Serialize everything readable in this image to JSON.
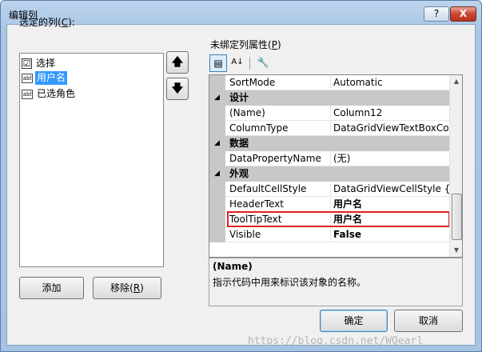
{
  "window": {
    "title": "编辑列",
    "help_label": "?",
    "close_label": "X"
  },
  "left": {
    "label_text": "选定的列",
    "label_accel": "C",
    "items": [
      {
        "icon": "checkbox-icon",
        "icon_glyph": "☑",
        "label": "选择",
        "selected": false
      },
      {
        "icon": "textbox-column-icon",
        "icon_glyph": "abl",
        "label": "用户名",
        "selected": true
      },
      {
        "icon": "textbox-column-icon",
        "icon_glyph": "abl",
        "label": "已选角色",
        "selected": false
      }
    ],
    "move_up_glyph": "🡅",
    "move_down_glyph": "🡇",
    "add_label": "添加",
    "remove_label": "移除",
    "remove_accel": "R"
  },
  "right": {
    "label_text": "未绑定列属性",
    "label_accel": "P",
    "toolbar": {
      "categorized_glyph": "▤",
      "alphabetical_glyph": "A↓",
      "property_pages_glyph": "🔧"
    },
    "rows": [
      {
        "kind": "prop",
        "name": "SortMode",
        "value": "Automatic",
        "bold": false
      },
      {
        "kind": "cat",
        "name": "设计",
        "toggle": "◢"
      },
      {
        "kind": "prop",
        "name": "(Name)",
        "value": "Column12",
        "bold": false
      },
      {
        "kind": "prop",
        "name": "ColumnType",
        "value": "DataGridViewTextBoxColu",
        "bold": false
      },
      {
        "kind": "cat",
        "name": "数据",
        "toggle": "◢"
      },
      {
        "kind": "prop",
        "name": "DataPropertyName",
        "value": "(无)",
        "bold": false
      },
      {
        "kind": "cat",
        "name": "外观",
        "toggle": "◢"
      },
      {
        "kind": "prop",
        "name": "DefaultCellStyle",
        "value": "DataGridViewCellStyle { }",
        "bold": false
      },
      {
        "kind": "prop",
        "name": "HeaderText",
        "value": "用户名",
        "bold": true
      },
      {
        "kind": "prop",
        "name": "ToolTipText",
        "value": "用户名",
        "bold": true,
        "highlighted": true
      },
      {
        "kind": "prop",
        "name": "Visible",
        "value": "False",
        "bold": true
      }
    ],
    "scroll_up_glyph": "▲",
    "scroll_down_glyph": "▼",
    "description": {
      "title": "(Name)",
      "text": "指示代码中用来标识该对象的名称。"
    }
  },
  "footer": {
    "ok_label": "确定",
    "cancel_label": "取消"
  },
  "watermark": "https://blog.csdn.net/WQearl",
  "colors": {
    "selection": "#3399ff",
    "highlight_border": "#e02020",
    "category_bg": "#c8c8c8"
  }
}
